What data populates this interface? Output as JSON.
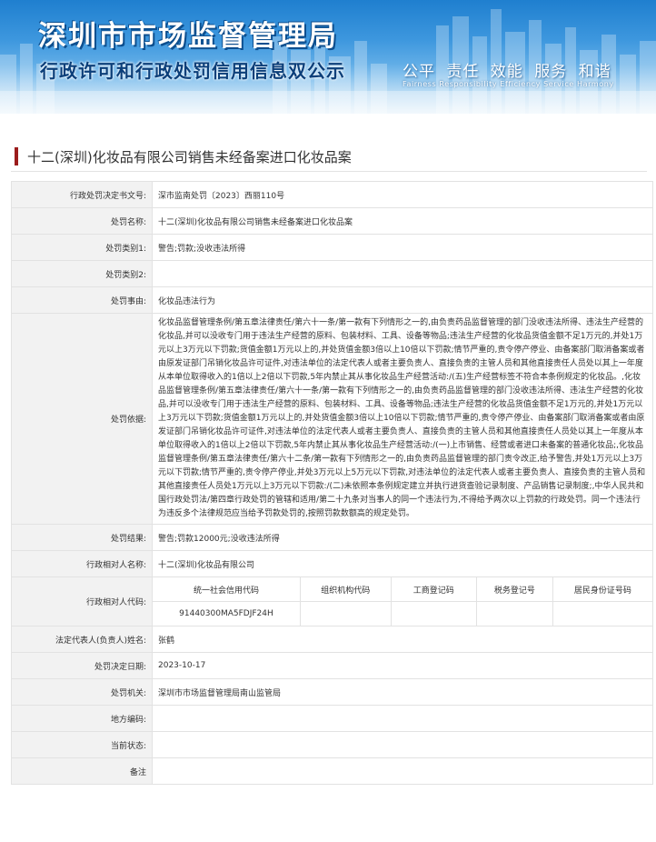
{
  "banner": {
    "title": "深圳市市场监督管理局",
    "subtitle": "行政许可和行政处罚信用信息双公示",
    "slogan": "公平 责任 效能 服务 和谐",
    "slogan_en": "Fairness Responsibility Efficiency Service Harmony"
  },
  "case_title": "十二(深圳)化妆品有限公司销售未经备案进口化妆品案",
  "fields": [
    {
      "label": "行政处罚决定书文号:",
      "value": "深市监南处罚〔2023〕西丽110号"
    },
    {
      "label": "处罚名称:",
      "value": "十二(深圳)化妆品有限公司销售未经备案进口化妆品案"
    },
    {
      "label": "处罚类别1:",
      "value": "警告;罚款;没收违法所得"
    },
    {
      "label": "处罚类别2:",
      "value": ""
    },
    {
      "label": "处罚事由:",
      "value": "化妆品违法行为"
    },
    {
      "label": "处罚依据:",
      "value": "化妆品监督管理条例/第五章法律责任/第六十一条/第一款有下列情形之一的,由负责药品监督管理的部门没收违法所得、违法生产经营的化妆品,并可以没收专门用于违法生产经营的原料、包装材料、工具、设备等物品;违法生产经营的化妆品货值金额不足1万元的,并处1万元以上3万元以下罚款;货值金额1万元以上的,并处货值金额3倍以上10倍以下罚款;情节严重的,责令停产停业、由备案部门取消备案或者由原发证部门吊销化妆品许可证件,对违法单位的法定代表人或者主要负责人、直接负责的主管人员和其他直接责任人员处以其上一年度从本单位取得收入的1倍以上2倍以下罚款,5年内禁止其从事化妆品生产经营活动:/(五)生产经营标签不符合本条例规定的化妆品。,化妆品监督管理条例/第五章法律责任/第六十一条/第一款有下列情形之一的,由负责药品监督管理的部门没收违法所得、违法生产经营的化妆品,并可以没收专门用于违法生产经营的原料、包装材料、工具、设备等物品;违法生产经营的化妆品货值金额不足1万元的,并处1万元以上3万元以下罚款;货值金额1万元以上的,并处货值金额3倍以上10倍以下罚款;情节严重的,责令停产停业、由备案部门取消备案或者由原发证部门吊销化妆品许可证件,对违法单位的法定代表人或者主要负责人、直接负责的主管人员和其他直接责任人员处以其上一年度从本单位取得收入的1倍以上2倍以下罚款,5年内禁止其从事化妆品生产经营活动:/(一)上市销售、经营或者进口未备案的普通化妆品;,化妆品监督管理条例/第五章法律责任/第六十二条/第一款有下列情形之一的,由负责药品监督管理的部门责令改正,给予警告,并处1万元以上3万元以下罚款;情节严重的,责令停产停业,并处3万元以上5万元以下罚款,对违法单位的法定代表人或者主要负责人、直接负责的主管人员和其他直接责任人员处1万元以上3万元以下罚款:/(二)未依照本条例规定建立并执行进货查验记录制度、产品销售记录制度;,中华人民共和国行政处罚法/第四章行政处罚的管辖和适用/第二十九条对当事人的同一个违法行为,不得给予两次以上罚款的行政处罚。同一个违法行为违反多个法律规范应当给予罚款处罚的,按照罚款数额高的规定处罚。"
    },
    {
      "label": "处罚结果:",
      "value": "警告;罚款12000元;没收违法所得"
    },
    {
      "label": "行政相对人名称:",
      "value": "十二(深圳)化妆品有限公司"
    }
  ],
  "codes": {
    "label": "行政相对人代码:",
    "headers": [
      "统一社会信用代码",
      "组织机构代码",
      "工商登记码",
      "税务登记号",
      "居民身份证号码"
    ],
    "values": [
      "91440300MA5FDJF24H",
      "",
      "",
      "",
      ""
    ]
  },
  "fields2": [
    {
      "label": "法定代表人(负责人)姓名:",
      "value": "张鹤"
    },
    {
      "label": "处罚决定日期:",
      "value": "2023-10-17"
    },
    {
      "label": "处罚机关:",
      "value": "深圳市市场监督管理局南山监管局"
    },
    {
      "label": "地方编码:",
      "value": ""
    },
    {
      "label": "当前状态:",
      "value": ""
    },
    {
      "label": "备注",
      "value": ""
    }
  ]
}
